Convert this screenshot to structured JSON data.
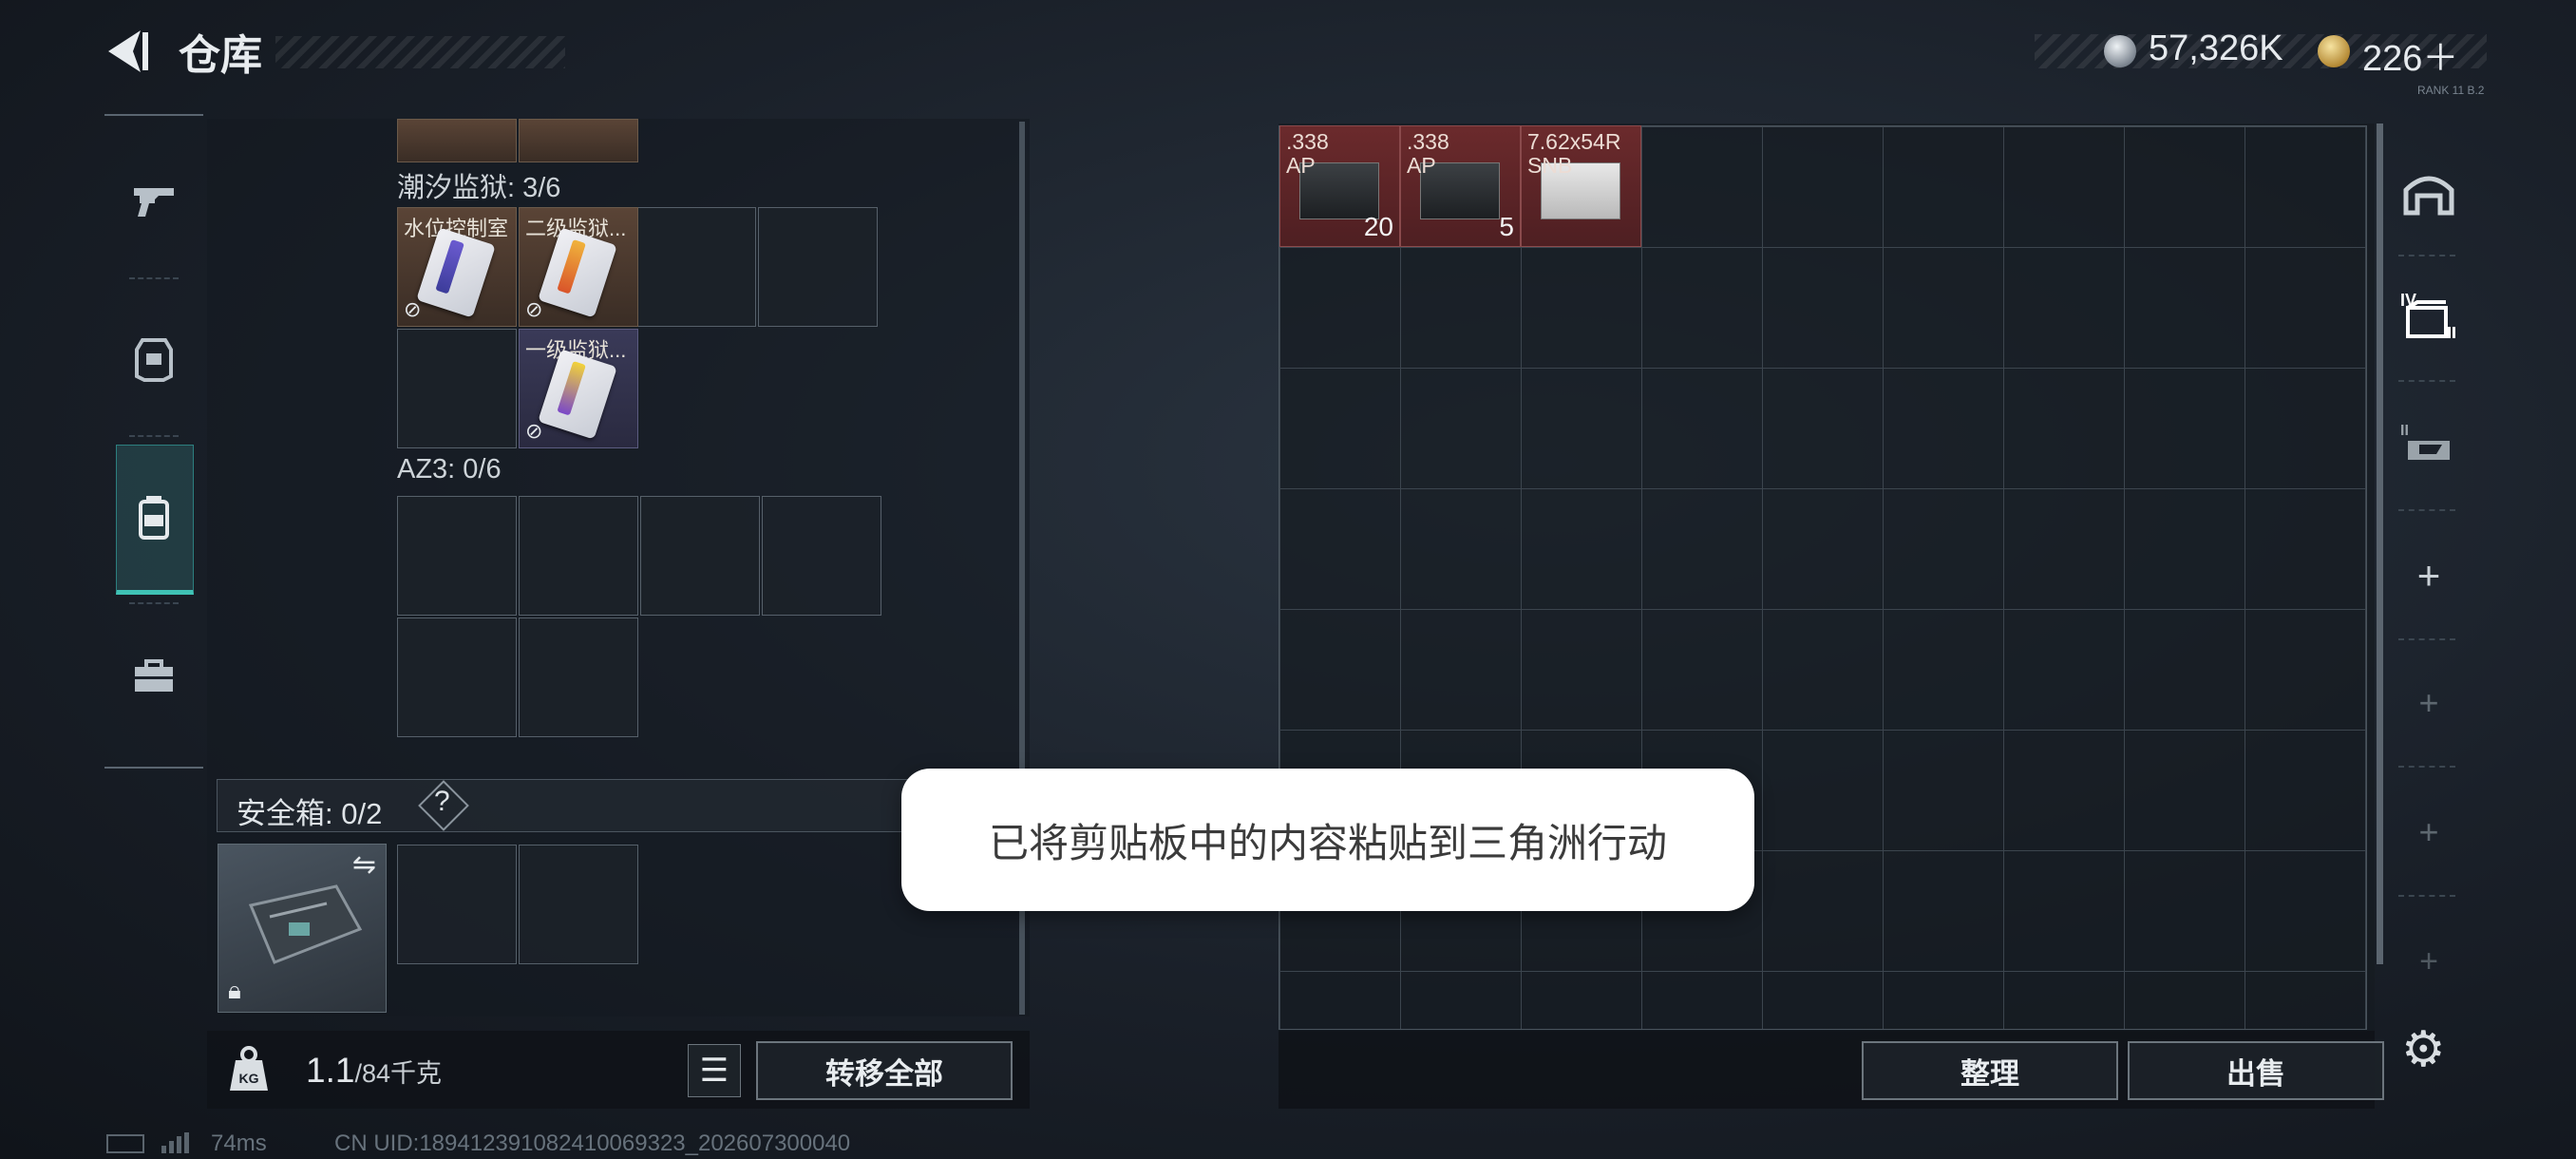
{
  "header": {
    "title": "仓库",
    "silver": "57,326K",
    "gold": "226＋",
    "badge": "RANK 11 B.2"
  },
  "left_panel": {
    "groups": [
      {
        "label": "潮汐监狱: 3/6",
        "items": [
          "水位控制室",
          "二级监狱...",
          "一级监狱..."
        ]
      },
      {
        "label": "AZ3: 0/6"
      }
    ],
    "safe_box_label": "安全箱: 0/2",
    "help": "?"
  },
  "bottom_left": {
    "weight": "1.1",
    "weight_unit": "/84千克",
    "transfer_all": "转移全部"
  },
  "stash": {
    "ammo": [
      {
        "name": ".338\nAP",
        "count": "20",
        "color": "#6b2a2c"
      },
      {
        "name": ".338\nAP",
        "count": "5",
        "color": "#6b2a2c"
      },
      {
        "name": "7.62x54R\nSNB",
        "count": "",
        "color": "#6b2a2c"
      }
    ]
  },
  "bottom_right": {
    "organize": "整理",
    "sell": "出售"
  },
  "toast": "已将剪贴板中的内容粘贴到三角洲行动",
  "status": {
    "ping": "74ms",
    "uid": "CN UID:189412391082410069323_202607300040"
  },
  "icons": [
    "back-arrow-icon",
    "gun-icon",
    "armor-icon",
    "backpack-icon",
    "briefcase-icon",
    "warehouse-icon",
    "container-icon",
    "weapon-storage-icon",
    "plus-icon",
    "gear-icon",
    "lock-icon",
    "swap-icon",
    "list-icon",
    "weight-icon"
  ]
}
